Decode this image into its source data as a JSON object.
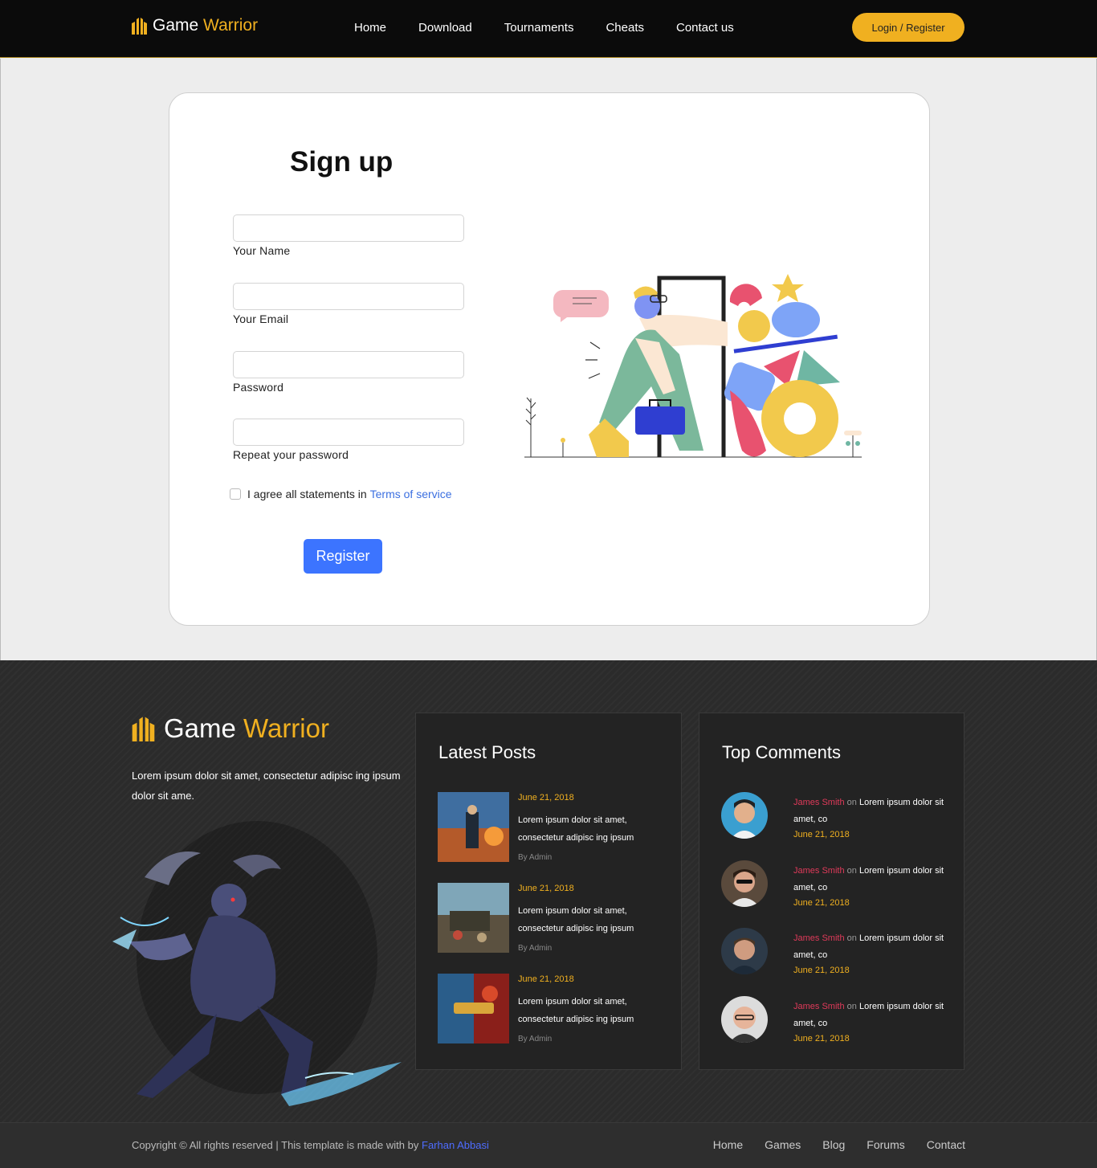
{
  "header": {
    "logo_first": "Game",
    "logo_second": "Warrior",
    "nav": [
      "Home",
      "Download",
      "Tournaments",
      "Cheats",
      "Contact us"
    ],
    "login_label": "Login / Register"
  },
  "signup": {
    "title": "Sign up",
    "fields": [
      {
        "label": "Your Name",
        "value": ""
      },
      {
        "label": "Your Email",
        "value": ""
      },
      {
        "label": "Password",
        "value": ""
      },
      {
        "label": "Repeat your password",
        "value": ""
      }
    ],
    "agree_text": "I agree all statements in",
    "agree_link": "Terms of service",
    "agree_checked": false,
    "register_label": "Register"
  },
  "footer": {
    "logo_first": "Game",
    "logo_second": "Warrior",
    "description": "Lorem ipsum dolor sit amet, consectetur adipisc ing ipsum dolor sit ame.",
    "latest_posts": {
      "title": "Latest Posts",
      "items": [
        {
          "date": "June 21, 2018",
          "text": "Lorem ipsum dolor sit amet, consectetur adipisc ing ipsum",
          "by": "By Admin"
        },
        {
          "date": "June 21, 2018",
          "text": "Lorem ipsum dolor sit amet, consectetur adipisc ing ipsum",
          "by": "By Admin"
        },
        {
          "date": "June 21, 2018",
          "text": "Lorem ipsum dolor sit amet, consectetur adipisc ing ipsum",
          "by": "By Admin"
        }
      ]
    },
    "top_comments": {
      "title": "Top Comments",
      "items": [
        {
          "name": "James Smith",
          "on": "on",
          "text": "Lorem ipsum dolor sit amet, co",
          "date": "June 21, 2018"
        },
        {
          "name": "James Smith",
          "on": "on",
          "text": "Lorem ipsum dolor sit amet, co",
          "date": "June 21, 2018"
        },
        {
          "name": "James Smith",
          "on": "on",
          "text": "Lorem ipsum dolor sit amet, co",
          "date": "June 21, 2018"
        },
        {
          "name": "James Smith",
          "on": "on",
          "text": "Lorem ipsum dolor sit amet, co",
          "date": "June 21, 2018"
        }
      ]
    },
    "copyright": "Copyright © All rights reserved | This template is made with by",
    "author": "Farhan Abbasi",
    "bottom_nav": [
      "Home",
      "Games",
      "Blog",
      "Forums",
      "Contact"
    ]
  },
  "colors": {
    "accent": "#f0b020",
    "primary_button": "#3c74ff",
    "link": "#3b6fe0",
    "comment_name": "#e03a5a"
  }
}
